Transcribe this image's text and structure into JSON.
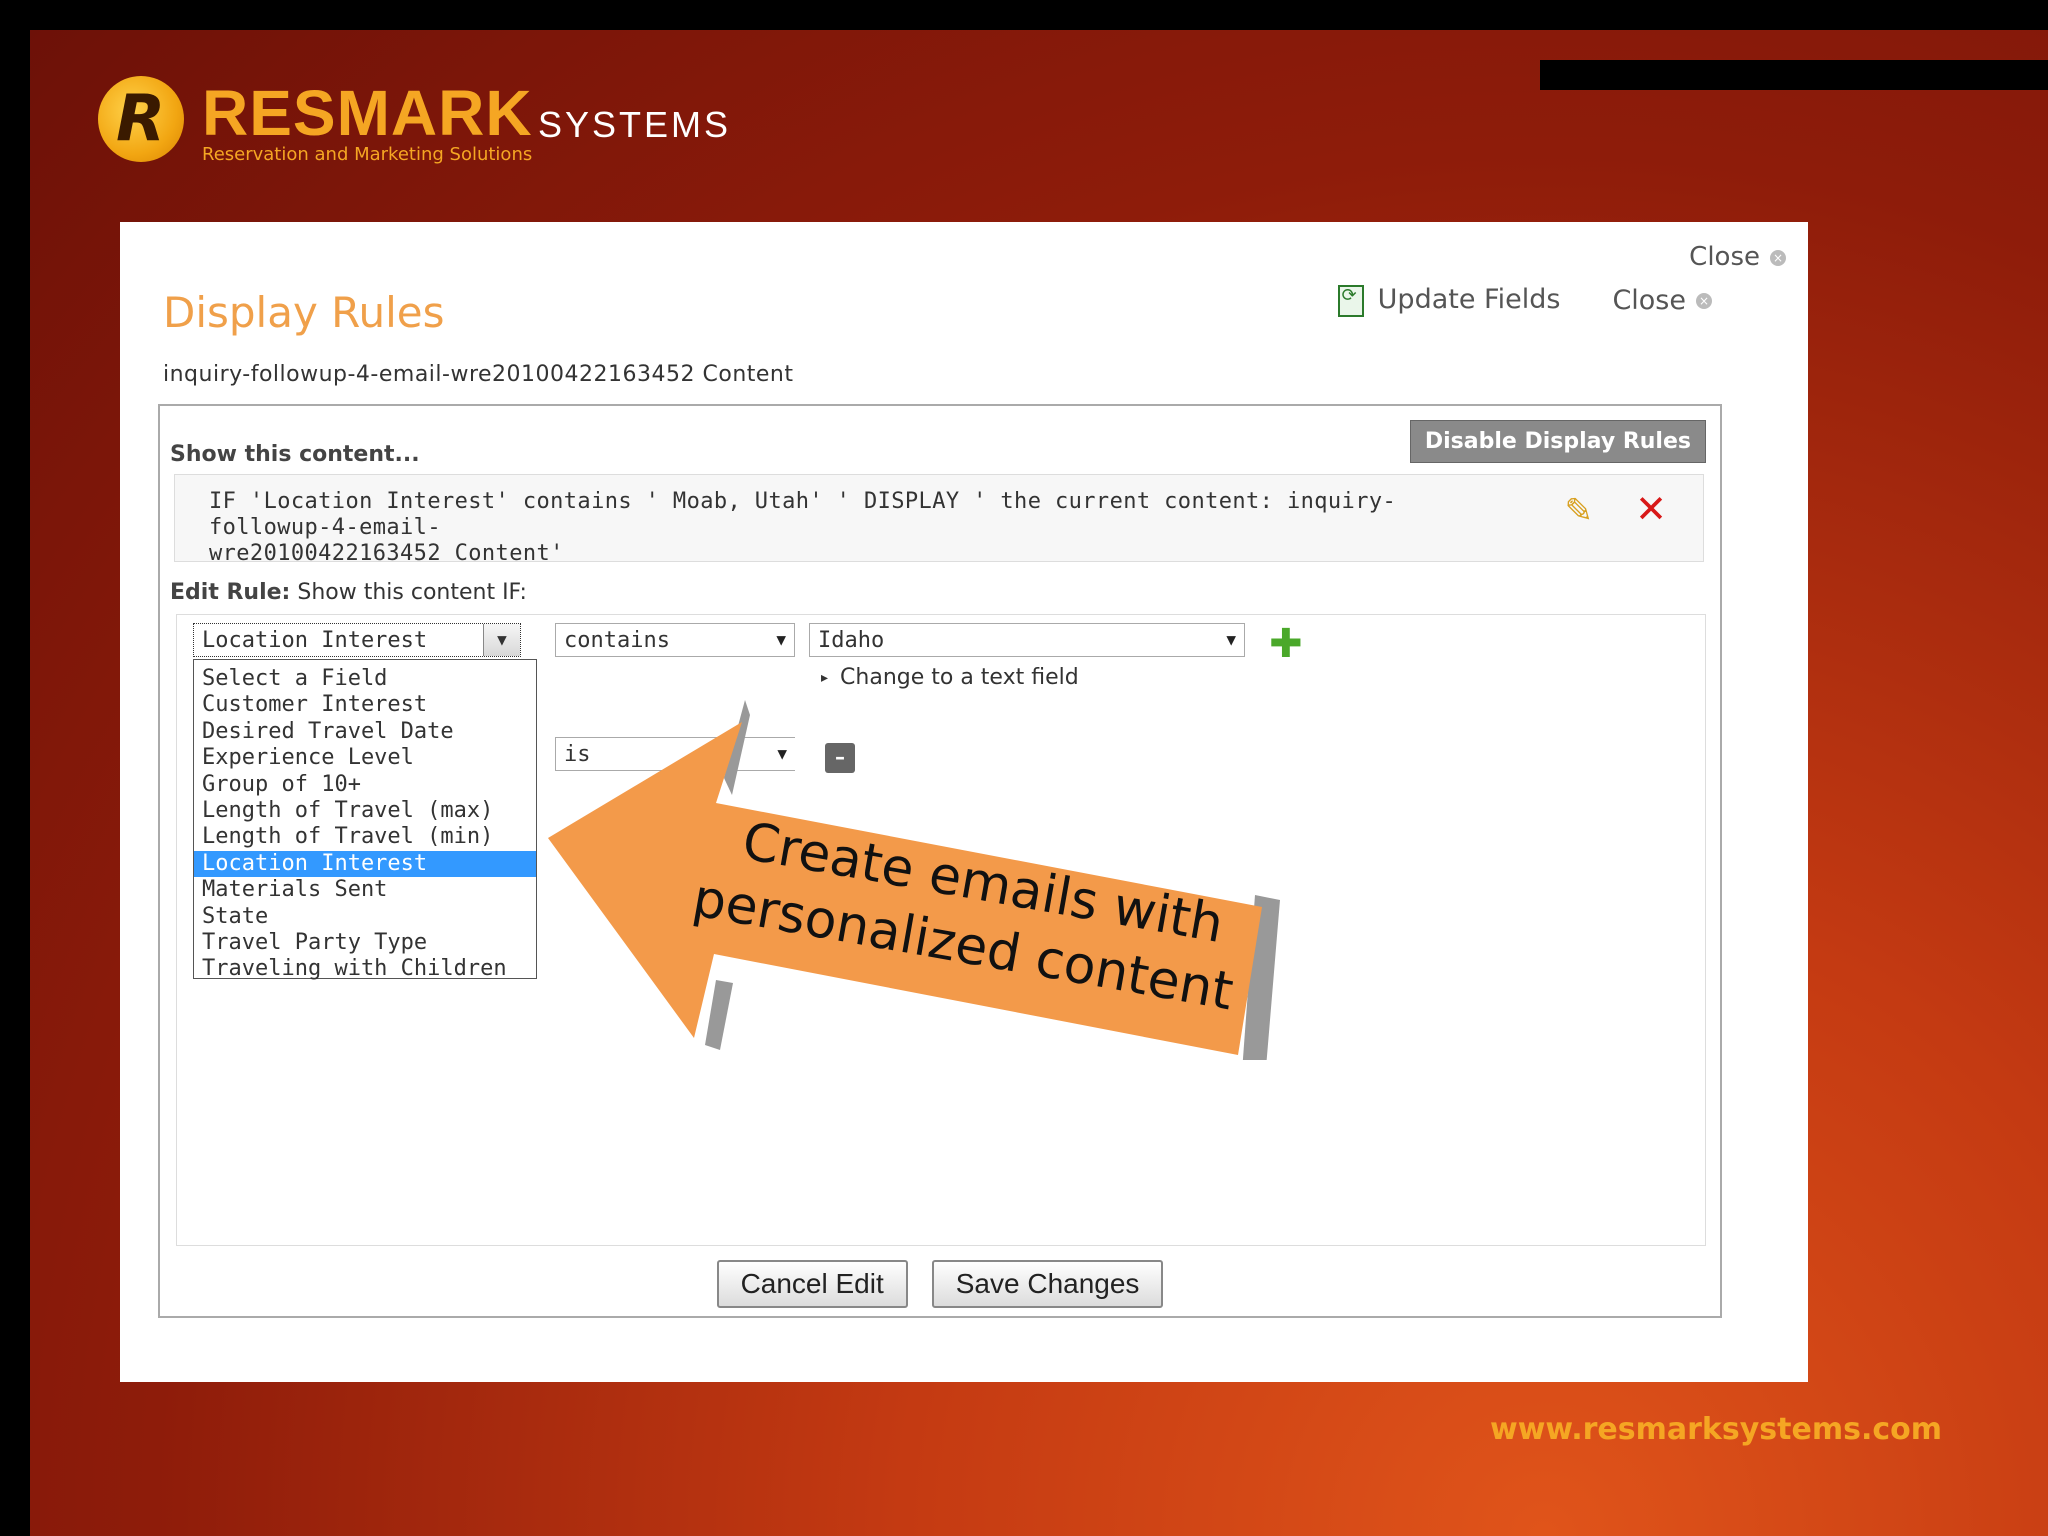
{
  "brand": {
    "res": "RESMARK",
    "systems": "SYSTEMS",
    "tagline": "Reservation and Marketing Solutions",
    "url": "www.resmarksystems.com",
    "logo_letter": "R"
  },
  "dialog": {
    "close_top": "Close",
    "update_fields": "Update Fields",
    "close": "Close",
    "title": "Display Rules",
    "subtitle": "inquiry-followup-4-email-wre20100422163452 Content"
  },
  "rules": {
    "show_label": "Show this content...",
    "disable_button": "Disable Display Rules",
    "rule_text_line1": "IF 'Location Interest' contains ' Moab, Utah' ' DISPLAY ' the current content: inquiry-followup-4-email-",
    "rule_text_line2": "wre20100422163452 Content'",
    "edit_label_bold": "Edit Rule:",
    "edit_label_rest": " Show this content IF:"
  },
  "editor": {
    "field_value": "Location Interest",
    "operator_value": "contains",
    "value_value": "Idaho",
    "change_link": "Change to a text field",
    "second_operator": "is",
    "dropdown_options": [
      "Select a Field",
      "Customer Interest",
      "Desired Travel Date",
      "Experience Level",
      "Group of 10+",
      "Length of Travel (max)",
      "Length of Travel (min)",
      "Location Interest",
      "Materials Sent",
      "State",
      "Travel Party Type",
      "Traveling with Children"
    ],
    "selected_index": 7
  },
  "buttons": {
    "cancel": "Cancel Edit",
    "save": "Save Changes"
  },
  "callout": {
    "line1": "Create emails with",
    "line2": "personalized content",
    "color": "#f39a4a"
  }
}
